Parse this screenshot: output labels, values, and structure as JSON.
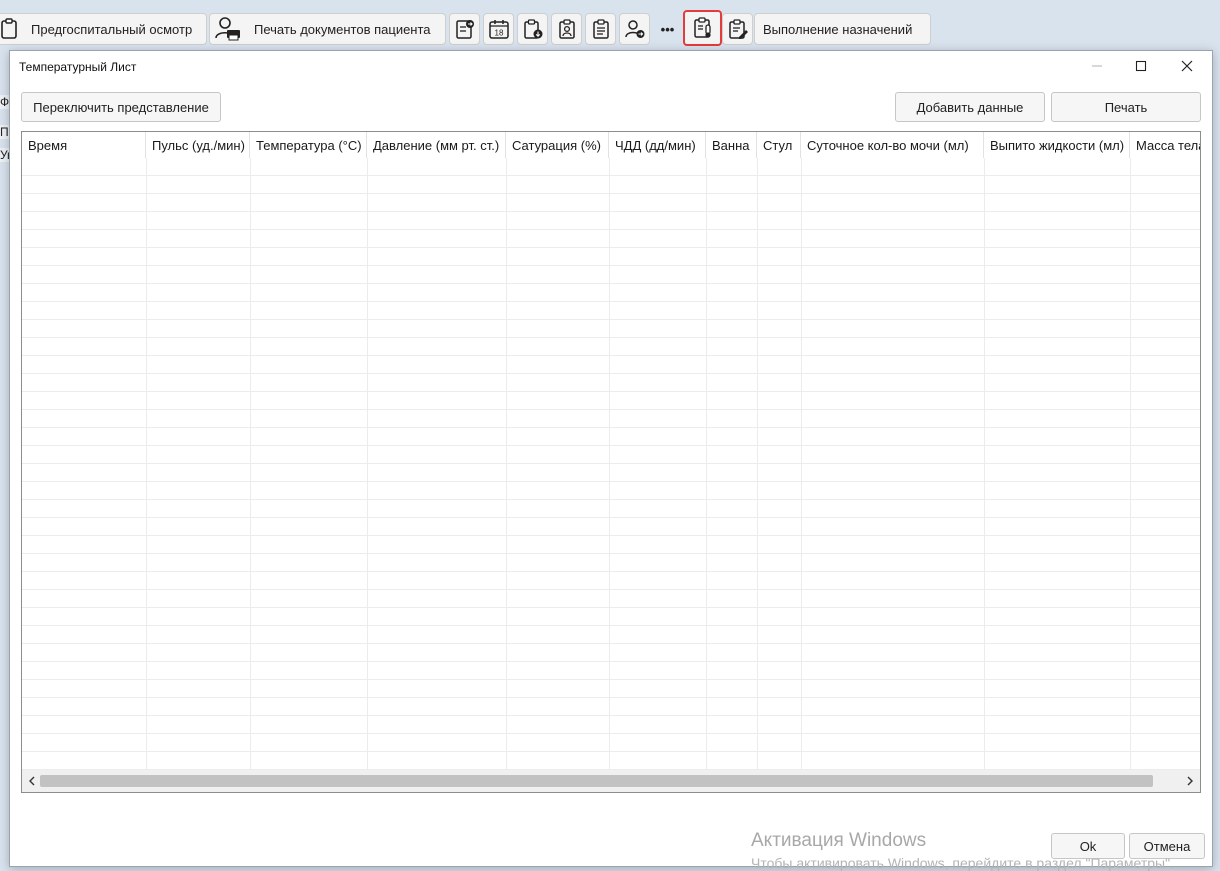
{
  "toolbar": {
    "pre_hospital_label": "Предгоспитальный осмотр",
    "print_docs_label": "Печать документов пациента",
    "calendar_day": "18",
    "more_label": "•••",
    "assignments_label": "Выполнение назначений"
  },
  "background_peek": [
    "Ф",
    "П",
    "Ув"
  ],
  "dialog": {
    "title": "Температурный Лист",
    "switch_view_label": "Переключить представление",
    "add_data_label": "Добавить данные",
    "print_label": "Печать",
    "ok_label": "Ok",
    "cancel_label": "Отмена"
  },
  "grid": {
    "columns": [
      "Время",
      "Пульс (уд./мин)",
      "Температура (°С)",
      "Давление (мм рт. ст.)",
      "Сатурация (%)",
      "ЧДД (дд/мин)",
      "Ванна",
      "Стул",
      "Суточное кол-во мочи (мл)",
      "Выпито жидкости (мл)",
      "Масса тела"
    ],
    "rows": []
  },
  "watermark": {
    "title": "Активация Windows",
    "subtitle": "Чтобы активировать Windows, перейдите в раздел \"Параметры\"."
  },
  "colors": {
    "highlight": "#e23c3c",
    "grid_border": "#8d8d8d"
  }
}
